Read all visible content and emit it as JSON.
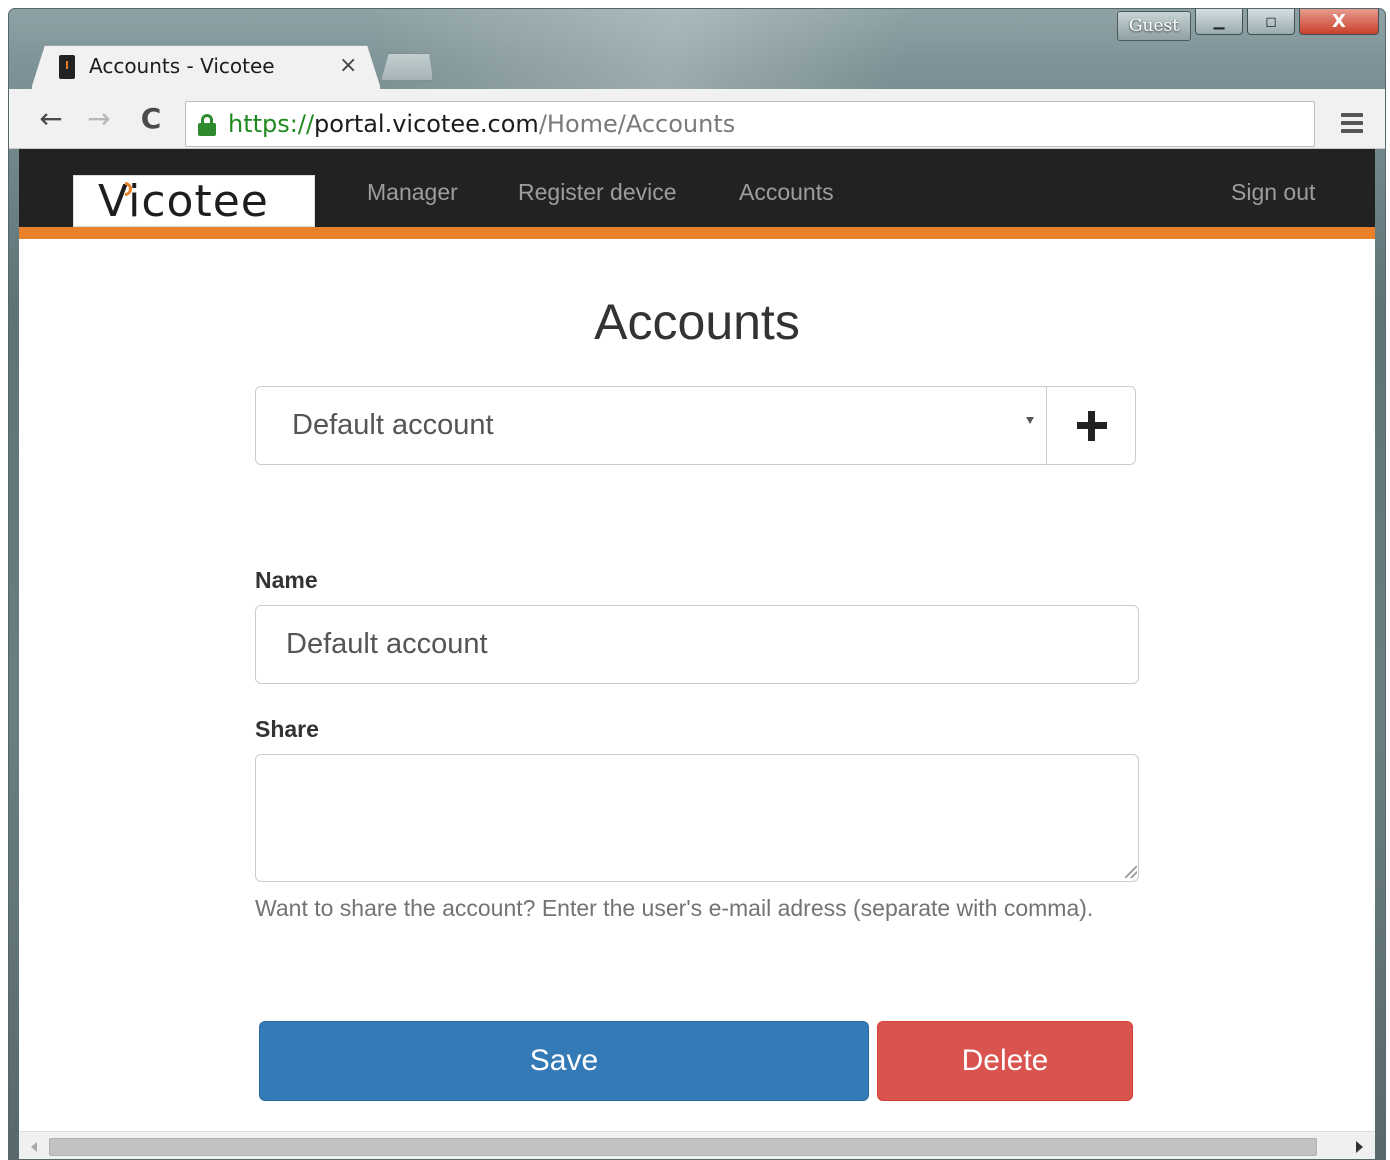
{
  "window": {
    "guest_label": "Guest",
    "minimize_symbol": "▁",
    "maximize_symbol": "◻",
    "close_symbol": "X"
  },
  "tab": {
    "title": "Accounts - Vicotee",
    "close_symbol": "×",
    "favicon": "vicotee-favicon"
  },
  "toolbar": {
    "back_symbol": "←",
    "forward_symbol": "→",
    "reload_symbol": "C",
    "url_scheme": "https://",
    "url_host": "portal.vicotee.com",
    "url_path": "/Home/Accounts"
  },
  "navbar": {
    "brand": "Vicotee",
    "links": [
      "Manager",
      "Register device",
      "Accounts"
    ],
    "sign_out": "Sign out"
  },
  "page": {
    "title": "Accounts",
    "selected_account": "Default account",
    "name_label": "Name",
    "name_value": "Default account",
    "share_label": "Share",
    "share_value": "",
    "help_text": "Want to share the account? Enter the user's e-mail adress (separate with comma).",
    "save_label": "Save",
    "delete_label": "Delete"
  },
  "colors": {
    "navbar_bg": "#222222",
    "accent_orange": "#e8812a",
    "save_blue": "#337ab7",
    "delete_red": "#d9534f"
  },
  "icons": [
    "lock-icon",
    "menu-icon",
    "plus-icon",
    "chevron-down-icon",
    "back-icon",
    "forward-icon",
    "reload-icon"
  ]
}
